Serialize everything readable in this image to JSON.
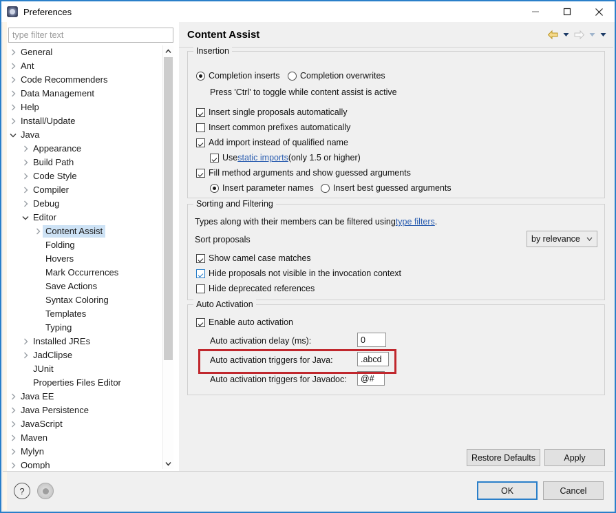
{
  "window": {
    "title": "Preferences",
    "icon": "preferences-icon",
    "minimize_label": "—",
    "maximize_label": "□",
    "close_label": "✕"
  },
  "filter": {
    "placeholder": "type filter text",
    "value": ""
  },
  "tree": {
    "items": [
      {
        "label": "General",
        "indent": 0,
        "twisty": "collapsed",
        "selected": false
      },
      {
        "label": "Ant",
        "indent": 0,
        "twisty": "collapsed",
        "selected": false
      },
      {
        "label": "Code Recommenders",
        "indent": 0,
        "twisty": "collapsed",
        "selected": false
      },
      {
        "label": "Data Management",
        "indent": 0,
        "twisty": "collapsed",
        "selected": false
      },
      {
        "label": "Help",
        "indent": 0,
        "twisty": "collapsed",
        "selected": false
      },
      {
        "label": "Install/Update",
        "indent": 0,
        "twisty": "collapsed",
        "selected": false
      },
      {
        "label": "Java",
        "indent": 0,
        "twisty": "expanded",
        "selected": false
      },
      {
        "label": "Appearance",
        "indent": 1,
        "twisty": "collapsed",
        "selected": false
      },
      {
        "label": "Build Path",
        "indent": 1,
        "twisty": "collapsed",
        "selected": false
      },
      {
        "label": "Code Style",
        "indent": 1,
        "twisty": "collapsed",
        "selected": false
      },
      {
        "label": "Compiler",
        "indent": 1,
        "twisty": "collapsed",
        "selected": false
      },
      {
        "label": "Debug",
        "indent": 1,
        "twisty": "collapsed",
        "selected": false
      },
      {
        "label": "Editor",
        "indent": 1,
        "twisty": "expanded",
        "selected": false
      },
      {
        "label": "Content Assist",
        "indent": 2,
        "twisty": "collapsed",
        "selected": true
      },
      {
        "label": "Folding",
        "indent": 2,
        "twisty": "none",
        "selected": false
      },
      {
        "label": "Hovers",
        "indent": 2,
        "twisty": "none",
        "selected": false
      },
      {
        "label": "Mark Occurrences",
        "indent": 2,
        "twisty": "none",
        "selected": false
      },
      {
        "label": "Save Actions",
        "indent": 2,
        "twisty": "none",
        "selected": false
      },
      {
        "label": "Syntax Coloring",
        "indent": 2,
        "twisty": "none",
        "selected": false
      },
      {
        "label": "Templates",
        "indent": 2,
        "twisty": "none",
        "selected": false
      },
      {
        "label": "Typing",
        "indent": 2,
        "twisty": "none",
        "selected": false
      },
      {
        "label": "Installed JREs",
        "indent": 1,
        "twisty": "collapsed",
        "selected": false
      },
      {
        "label": "JadClipse",
        "indent": 1,
        "twisty": "collapsed",
        "selected": false
      },
      {
        "label": "JUnit",
        "indent": 1,
        "twisty": "none",
        "selected": false
      },
      {
        "label": "Properties Files Editor",
        "indent": 1,
        "twisty": "none",
        "selected": false
      },
      {
        "label": "Java EE",
        "indent": 0,
        "twisty": "collapsed",
        "selected": false
      },
      {
        "label": "Java Persistence",
        "indent": 0,
        "twisty": "collapsed",
        "selected": false
      },
      {
        "label": "JavaScript",
        "indent": 0,
        "twisty": "collapsed",
        "selected": false
      },
      {
        "label": "Maven",
        "indent": 0,
        "twisty": "collapsed",
        "selected": false
      },
      {
        "label": "Mylyn",
        "indent": 0,
        "twisty": "collapsed",
        "selected": false
      },
      {
        "label": "Oomph",
        "indent": 0,
        "twisty": "collapsed",
        "selected": false
      }
    ]
  },
  "page": {
    "title": "Content Assist",
    "nav": {
      "back": "back-arrow",
      "back_menu": "back-dropdown",
      "forward": "forward-arrow",
      "forward_menu": "forward-dropdown",
      "view_menu": "view-dropdown"
    }
  },
  "insertion": {
    "legend": "Insertion",
    "radio_inserts": {
      "label": "Completion inserts",
      "selected": true
    },
    "radio_overwrites": {
      "label": "Completion overwrites",
      "selected": false
    },
    "hint": "Press 'Ctrl' to toggle while content assist is active",
    "cb_single": {
      "label": "Insert single proposals automatically",
      "checked": true
    },
    "cb_prefixes": {
      "label": "Insert common prefixes automatically",
      "checked": false
    },
    "cb_import": {
      "label": "Add import instead of qualified name",
      "checked": true
    },
    "cb_static": {
      "checked": true,
      "pre": "Use ",
      "link": "static imports",
      "post": " (only 1.5 or higher)"
    },
    "cb_fill": {
      "label": "Fill method arguments and show guessed arguments",
      "checked": true
    },
    "radio_param_names": {
      "label": "Insert parameter names",
      "selected": true
    },
    "radio_best_guessed": {
      "label": "Insert best guessed arguments",
      "selected": false
    }
  },
  "sorting": {
    "legend": "Sorting and Filtering",
    "desc_pre": "Types along with their members can be filtered using ",
    "desc_link": "type filters",
    "desc_post": ".",
    "sort_label": "Sort proposals",
    "sort_value": "by relevance",
    "cb_camel": {
      "label": "Show camel case matches",
      "checked": true
    },
    "cb_hide_invis": {
      "label": "Hide proposals not visible in the invocation context",
      "checked": true,
      "focused": true
    },
    "cb_hide_depr": {
      "label": "Hide deprecated references",
      "checked": false
    }
  },
  "auto_activation": {
    "legend": "Auto Activation",
    "cb_enable": {
      "label": "Enable auto activation",
      "checked": true
    },
    "delay_label": "Auto activation delay (ms):",
    "delay_value": "0",
    "java_label": "Auto activation triggers for Java:",
    "java_value": ".abcd",
    "javadoc_label": "Auto activation triggers for Javadoc:",
    "javadoc_value": "@#"
  },
  "annotation": {
    "color": "#c0272d",
    "target": "auto-activation-triggers-for-java-row"
  },
  "buttons": {
    "restore_defaults": "Restore Defaults",
    "apply": "Apply",
    "ok": "OK",
    "cancel": "Cancel"
  },
  "bottom_icons": {
    "help": "?",
    "extra": "apply-and-close-icon"
  },
  "colors": {
    "accent": "#2a7fc9",
    "selection": "#cde2f5",
    "annotation": "#c0272d",
    "link": "#2a5db0"
  }
}
